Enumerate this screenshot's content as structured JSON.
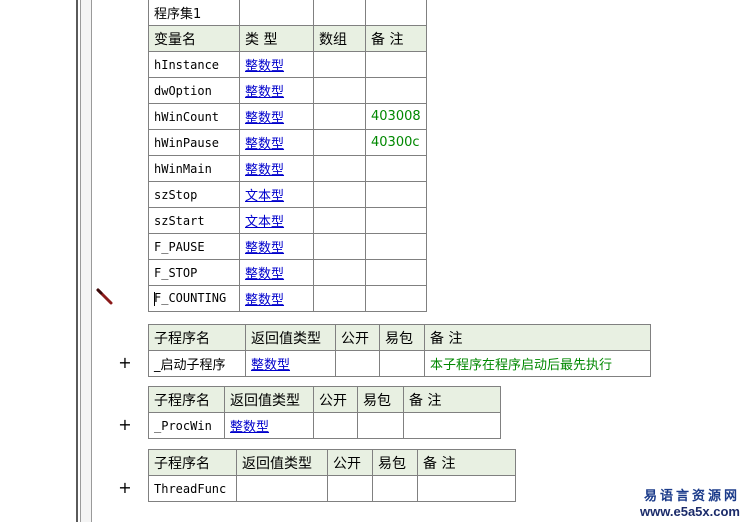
{
  "var_table": {
    "title": "程序集1",
    "headers": [
      "变量名",
      "类 型",
      "数组",
      "备 注"
    ],
    "rows": [
      {
        "name": "hInstance",
        "type": "整数型",
        "array": "",
        "note": ""
      },
      {
        "name": "dwOption",
        "type": "整数型",
        "array": "",
        "note": ""
      },
      {
        "name": "hWinCount",
        "type": "整数型",
        "array": "",
        "note": "403008"
      },
      {
        "name": "hWinPause",
        "type": "整数型",
        "array": "",
        "note": "40300c"
      },
      {
        "name": "hWinMain",
        "type": "整数型",
        "array": "",
        "note": ""
      },
      {
        "name": "szStop",
        "type": "文本型",
        "array": "",
        "note": ""
      },
      {
        "name": "szStart",
        "type": "文本型",
        "array": "",
        "note": ""
      },
      {
        "name": "F_PAUSE",
        "type": "整数型",
        "array": "",
        "note": ""
      },
      {
        "name": "F_STOP",
        "type": "整数型",
        "array": "",
        "note": ""
      },
      {
        "name": "F_COUNTING",
        "type": "整数型",
        "array": "",
        "note": ""
      }
    ]
  },
  "subs": [
    {
      "headers": [
        "子程序名",
        "返回值类型",
        "公开",
        "易包",
        "备 注"
      ],
      "name": "_启动子程序",
      "ret": "整数型",
      "public": "",
      "pkg": "",
      "note": "本子程序在程序启动后最先执行",
      "expand": "+"
    },
    {
      "headers": [
        "子程序名",
        "返回值类型",
        "公开",
        "易包",
        "备 注"
      ],
      "name": "_ProcWin",
      "ret": "整数型",
      "public": "",
      "pkg": "",
      "note": "",
      "expand": "+"
    },
    {
      "headers": [
        "子程序名",
        "返回值类型",
        "公开",
        "易包",
        "备 注"
      ],
      "name": "ThreadFunc",
      "ret": "",
      "public": "",
      "pkg": "",
      "note": "",
      "expand": "+"
    }
  ],
  "watermark": {
    "cn": "易语言资源网",
    "url": "www.e5a5x.com"
  },
  "icons": {
    "edit_marker": "pencil-icon"
  }
}
